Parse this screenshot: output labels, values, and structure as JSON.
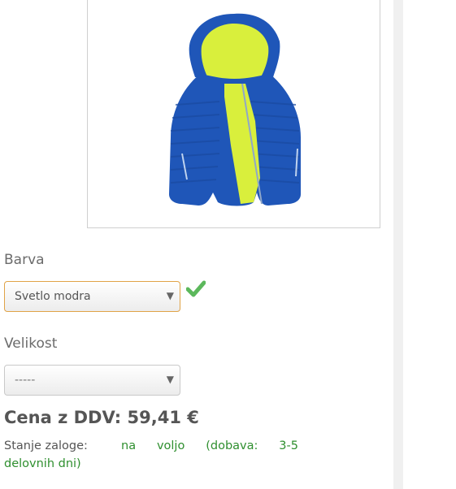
{
  "colors": {
    "accent_border": "#e0a347",
    "stock_green": "#2f8f2f",
    "check_green": "#5cb85c"
  },
  "product": {
    "image_icon": "blue-puffer-jacket-image"
  },
  "options": {
    "color_label": "Barva",
    "color_selected": "Svetlo modra",
    "color_valid_icon": "checkmark-icon",
    "size_label": "Velikost",
    "size_selected": "-----"
  },
  "price": {
    "text": "Cena z DDV: 59,41 €"
  },
  "stock": {
    "label": "Stanje zaloge:",
    "words": [
      "na",
      "voljo",
      "(dobava:",
      "3-5"
    ],
    "line2": "delovnih dni)"
  }
}
